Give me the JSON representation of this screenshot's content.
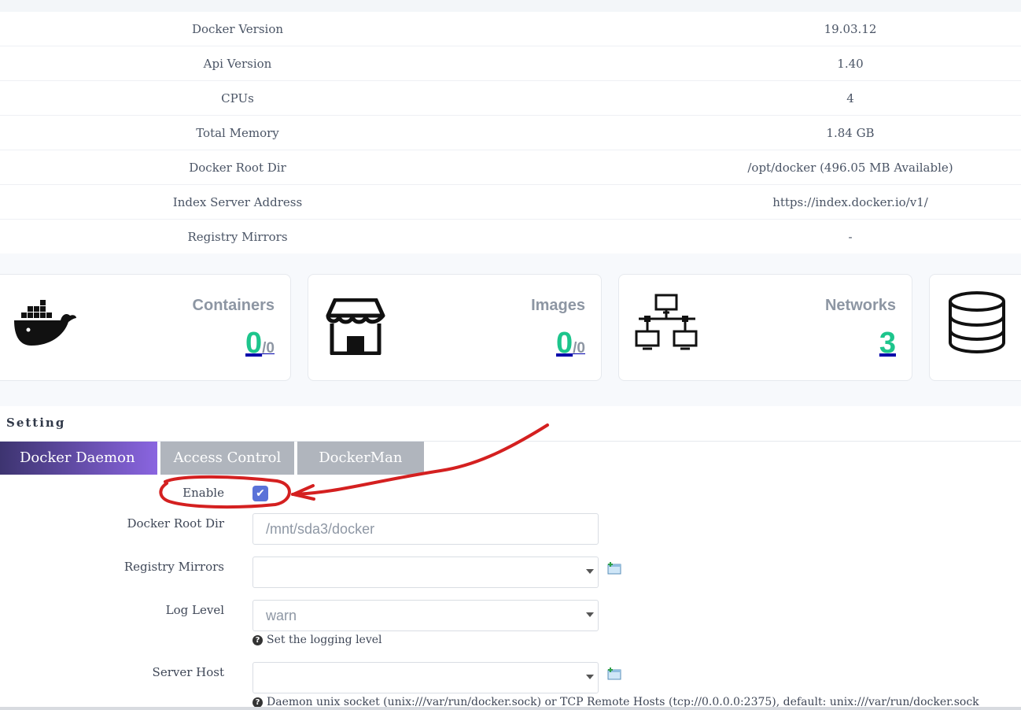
{
  "info": [
    {
      "key": "Docker Version",
      "value": "19.03.12"
    },
    {
      "key": "Api Version",
      "value": "1.40"
    },
    {
      "key": "CPUs",
      "value": "4"
    },
    {
      "key": "Total Memory",
      "value": "1.84 GB"
    },
    {
      "key": "Docker Root Dir",
      "value": "/opt/docker (496.05 MB Available)"
    },
    {
      "key": "Index Server Address",
      "value": "https://index.docker.io/v1/"
    },
    {
      "key": "Registry Mirrors",
      "value": "-"
    }
  ],
  "cards": {
    "containers": {
      "title": "Containers",
      "count": "0",
      "total": "/0",
      "icon": "docker-whale-icon"
    },
    "images": {
      "title": "Images",
      "count": "0",
      "total": "/0",
      "icon": "storefront-icon"
    },
    "networks": {
      "title": "Networks",
      "count": "3",
      "icon": "network-icon"
    },
    "volumes": {
      "icon": "database-icon"
    }
  },
  "setting": {
    "title": "Setting",
    "tabs": [
      {
        "label": "Docker Daemon",
        "active": true
      },
      {
        "label": "Access Control",
        "active": false
      },
      {
        "label": "DockerMan",
        "active": false
      }
    ],
    "fields": {
      "enable": {
        "label": "Enable",
        "checked": true
      },
      "root_dir": {
        "label": "Docker Root Dir",
        "placeholder": "/mnt/sda3/docker",
        "value": ""
      },
      "registry_mirrors": {
        "label": "Registry Mirrors",
        "value": ""
      },
      "log_level": {
        "label": "Log Level",
        "value": "warn",
        "help": "Set the logging level"
      },
      "server_host": {
        "label": "Server Host",
        "value": "",
        "help": "Daemon unix socket (unix:///var/run/docker.sock) or TCP Remote Hosts (tcp://0.0.0.0:2375), default: unix:///var/run/docker.sock"
      }
    }
  },
  "colors": {
    "accent_gradient_start": "#3d3470",
    "accent_gradient_end": "#8a65e0",
    "count_green": "#1dc58c",
    "annotation_red": "#d42020",
    "checkbox_blue": "#5a72d8"
  }
}
